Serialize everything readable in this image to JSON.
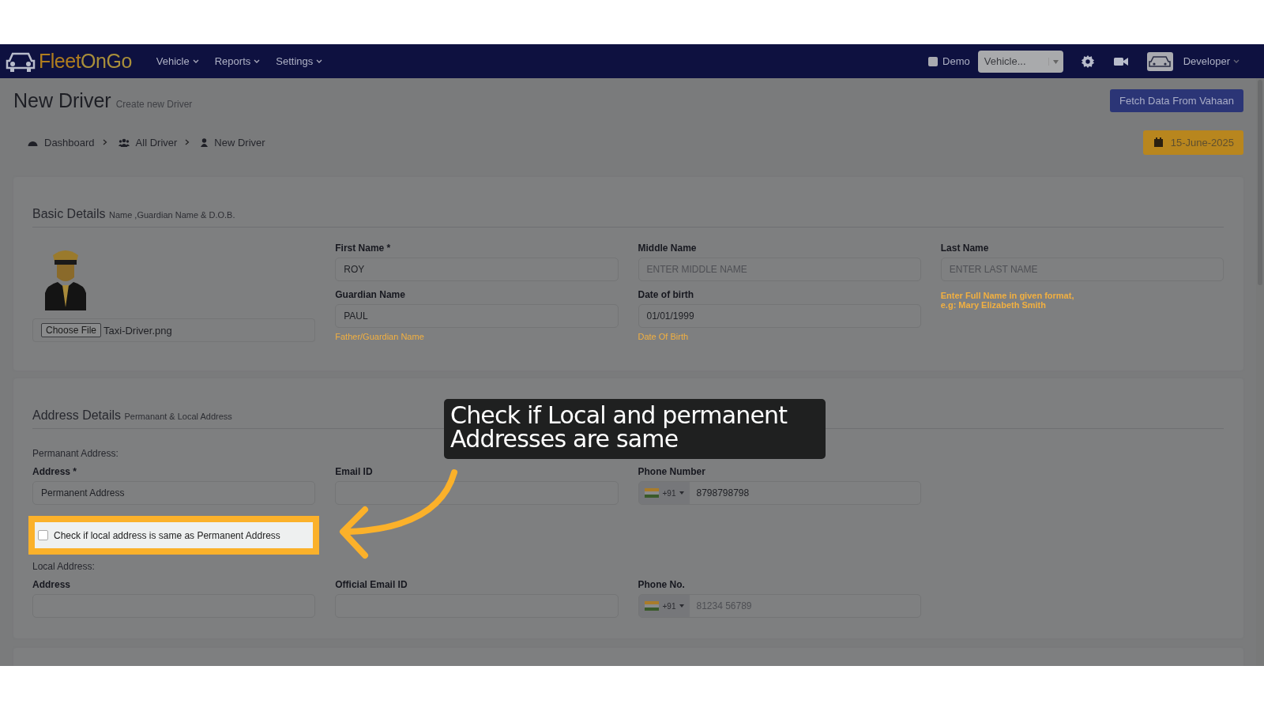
{
  "navbar": {
    "brand": {
      "part_1": "Fleet",
      "part_2": "On",
      "part_3": "Go"
    },
    "menus": [
      {
        "label": "Vehicle"
      },
      {
        "label": "Reports"
      },
      {
        "label": "Settings"
      }
    ],
    "demo": {
      "label": "Demo",
      "checked": false
    },
    "vehicle_select": {
      "value": "Vehicle..."
    },
    "user": {
      "name": "Developer"
    }
  },
  "header": {
    "title": "New Driver",
    "subtitle": "Create new Driver",
    "button": "Fetch Data From Vahaan"
  },
  "breadcrumb": [
    {
      "label": "Dashboard",
      "kind": "dashboard"
    },
    {
      "label": "All Driver",
      "kind": "group"
    },
    {
      "label": "New Driver",
      "kind": "person"
    }
  ],
  "date_badge": "15-June-2025",
  "basic": {
    "title": "Basic Details",
    "subtitle": "Name ,Guardian Name & D.O.B.",
    "file": {
      "button": "Choose File",
      "name": "Taxi-Driver.png"
    },
    "fields": [
      {
        "label": "First Name *",
        "value": "ROY"
      },
      {
        "label": "Middle Name",
        "placeholder": "ENTER MIDDLE NAME"
      },
      {
        "label": "Last Name",
        "placeholder": "ENTER LAST NAME"
      },
      {
        "label": "Guardian Name",
        "value": "PAUL",
        "hint": "Father/Guardian Name"
      },
      {
        "label": "Date of birth",
        "value": "01/01/1999",
        "hint": "Date Of Birth"
      }
    ],
    "name_hint": [
      "Enter Full Name in given format,",
      "e.g: Mary Elizabeth Smith"
    ]
  },
  "address": {
    "title": "Address Details",
    "subtitle": "Permanant & Local Address",
    "permanent_heading": "Permanant Address:",
    "permanent": [
      {
        "kind": "text",
        "label": "Address *",
        "value": "Permanent Address"
      },
      {
        "kind": "text",
        "label": "Email ID"
      },
      {
        "kind": "phone",
        "label": "Phone Number",
        "code": "+91",
        "value": "8798798798"
      }
    ],
    "same_check": {
      "label": "Check if local address is same as Permanent Address",
      "checked": false
    },
    "local_heading": "Local Address:",
    "local": [
      {
        "kind": "text",
        "label": "Address"
      },
      {
        "kind": "text",
        "label": "Official Email ID"
      },
      {
        "kind": "phone",
        "label": "Phone No.",
        "code": "+91",
        "placeholder": "81234 56789"
      }
    ]
  },
  "callout": "Check if Local and permanent Addresses are same"
}
